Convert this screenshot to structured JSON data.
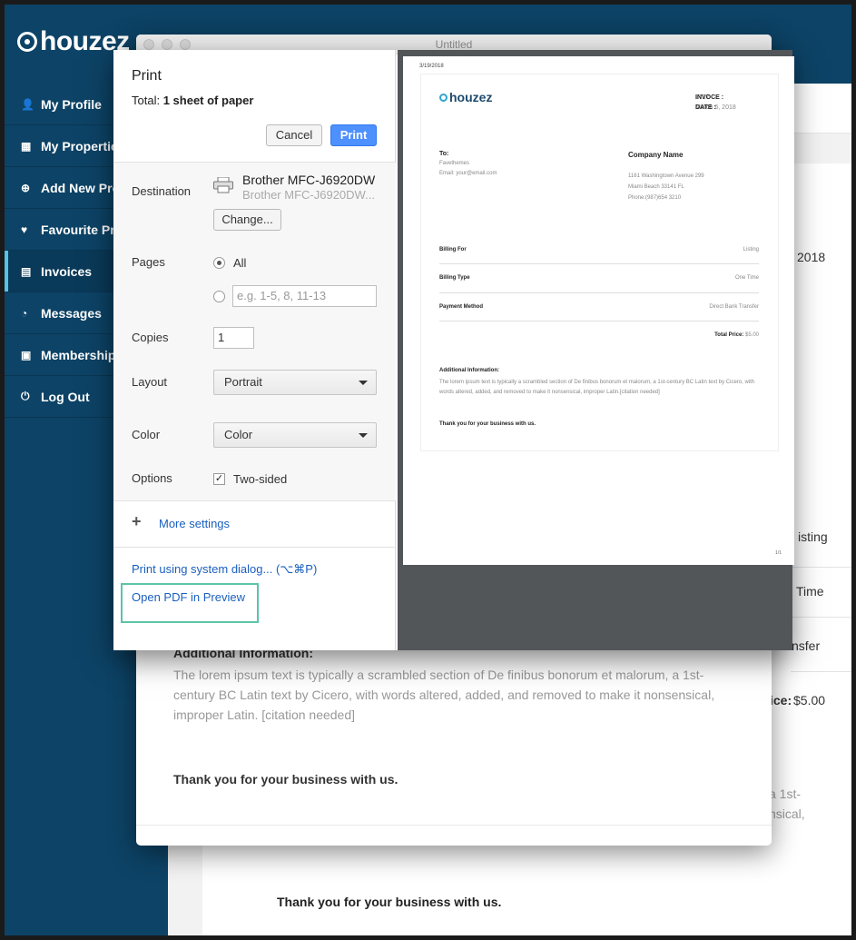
{
  "brand": {
    "name": "houzez"
  },
  "sidebar": {
    "items": [
      {
        "icon": "user-icon",
        "glyph": "👤",
        "label": "My Profile",
        "active": false
      },
      {
        "icon": "building-icon",
        "glyph": "▦",
        "label": "My Properties",
        "active": false
      },
      {
        "icon": "plus-circle-icon",
        "glyph": "⊕",
        "label": "Add New Property",
        "active": false
      },
      {
        "icon": "heart-icon",
        "glyph": "♥",
        "label": "Favourite Properties",
        "active": false
      },
      {
        "icon": "file-icon",
        "glyph": "▤",
        "label": "Invoices",
        "active": true
      },
      {
        "icon": "chat-icon",
        "glyph": "◔",
        "label": "Messages",
        "active": false
      },
      {
        "icon": "id-card-icon",
        "glyph": "▣",
        "label": "Membership",
        "active": false
      },
      {
        "icon": "logout-icon",
        "glyph": "⏻",
        "label": "Log Out",
        "active": false
      }
    ]
  },
  "background_page": {
    "date_fragment": "2018",
    "listing_fragment": "isting",
    "time_fragment": "Time",
    "transfer_fragment": "nsfer",
    "price_label_fragment": "ice:",
    "price_value": "$5.00",
    "lorem_fragment_1": "a 1st-",
    "lorem_fragment_2": "nsical,",
    "thanks": "Thank you for your business with us."
  },
  "invoice_window": {
    "title": "Untitled",
    "additional_heading": "Additional Information:",
    "additional_text": "The lorem ipsum text is typically a scrambled section of De finibus bonorum et malorum, a 1st-century BC Latin text by Cicero, with words altered, added, and removed to make it nonsensical, improper Latin. [citation needed]",
    "thanks": "Thank you for your business with us."
  },
  "print_dialog": {
    "title": "Print",
    "total_label": "Total:",
    "total_value": "1 sheet of paper",
    "cancel_label": "Cancel",
    "print_label": "Print",
    "destination_label": "Destination",
    "printer_name": "Brother MFC-J6920DW",
    "printer_sub": "Brother MFC-J6920DW...",
    "change_label": "Change...",
    "pages_label": "Pages",
    "pages_all": "All",
    "pages_placeholder": "e.g. 1-5, 8, 11-13",
    "copies_label": "Copies",
    "copies_value": "1",
    "layout_label": "Layout",
    "layout_value": "Portrait",
    "color_label": "Color",
    "color_value": "Color",
    "options_label": "Options",
    "two_sided_label": "Two-sided",
    "more_settings_label": "More settings",
    "system_dialog_label": "Print using system dialog... (⌥⌘P)",
    "open_pdf_label": "Open PDF in Preview"
  },
  "preview_sheet": {
    "date": "3/19/2018",
    "logo": "houzez",
    "invoice_label": "INVOCE :",
    "invoice_no": "2727",
    "date_label": "DATE :",
    "date_value": "March 6, 2018",
    "to_label": "To:",
    "to_name": "Favethemes",
    "to_email": "Email: your@email.com",
    "company_name": "Company Name",
    "company_address1": "1161 Washingtown Avenue 299",
    "company_address2": "Miami Beach 33141 FL",
    "company_phone": "Phone:(987)654 3210",
    "rows": [
      {
        "label": "Billing For",
        "value": "Listing"
      },
      {
        "label": "Billing Type",
        "value": "One Time"
      },
      {
        "label": "Payment Method",
        "value": "Direct Bank Transfer"
      }
    ],
    "total_label": "Total Price:",
    "total_value": "$5.00",
    "additional_heading": "Additional Information:",
    "additional_text": "The lorem ipsum text is typically a scrambled section of De finibus bonorum et malorum, a 1st-century BC Latin text by Cicero, with words altered, added, and removed to make it nonsensical, improper Latin.[citation needed]",
    "thanks": "Thank you for your business with us.",
    "page_number": "1/1"
  },
  "colors": {
    "sidebar": "#0d4366",
    "accent": "#56c2e6",
    "print_button": "#4d90fe",
    "highlight": "#5bc4a8"
  }
}
